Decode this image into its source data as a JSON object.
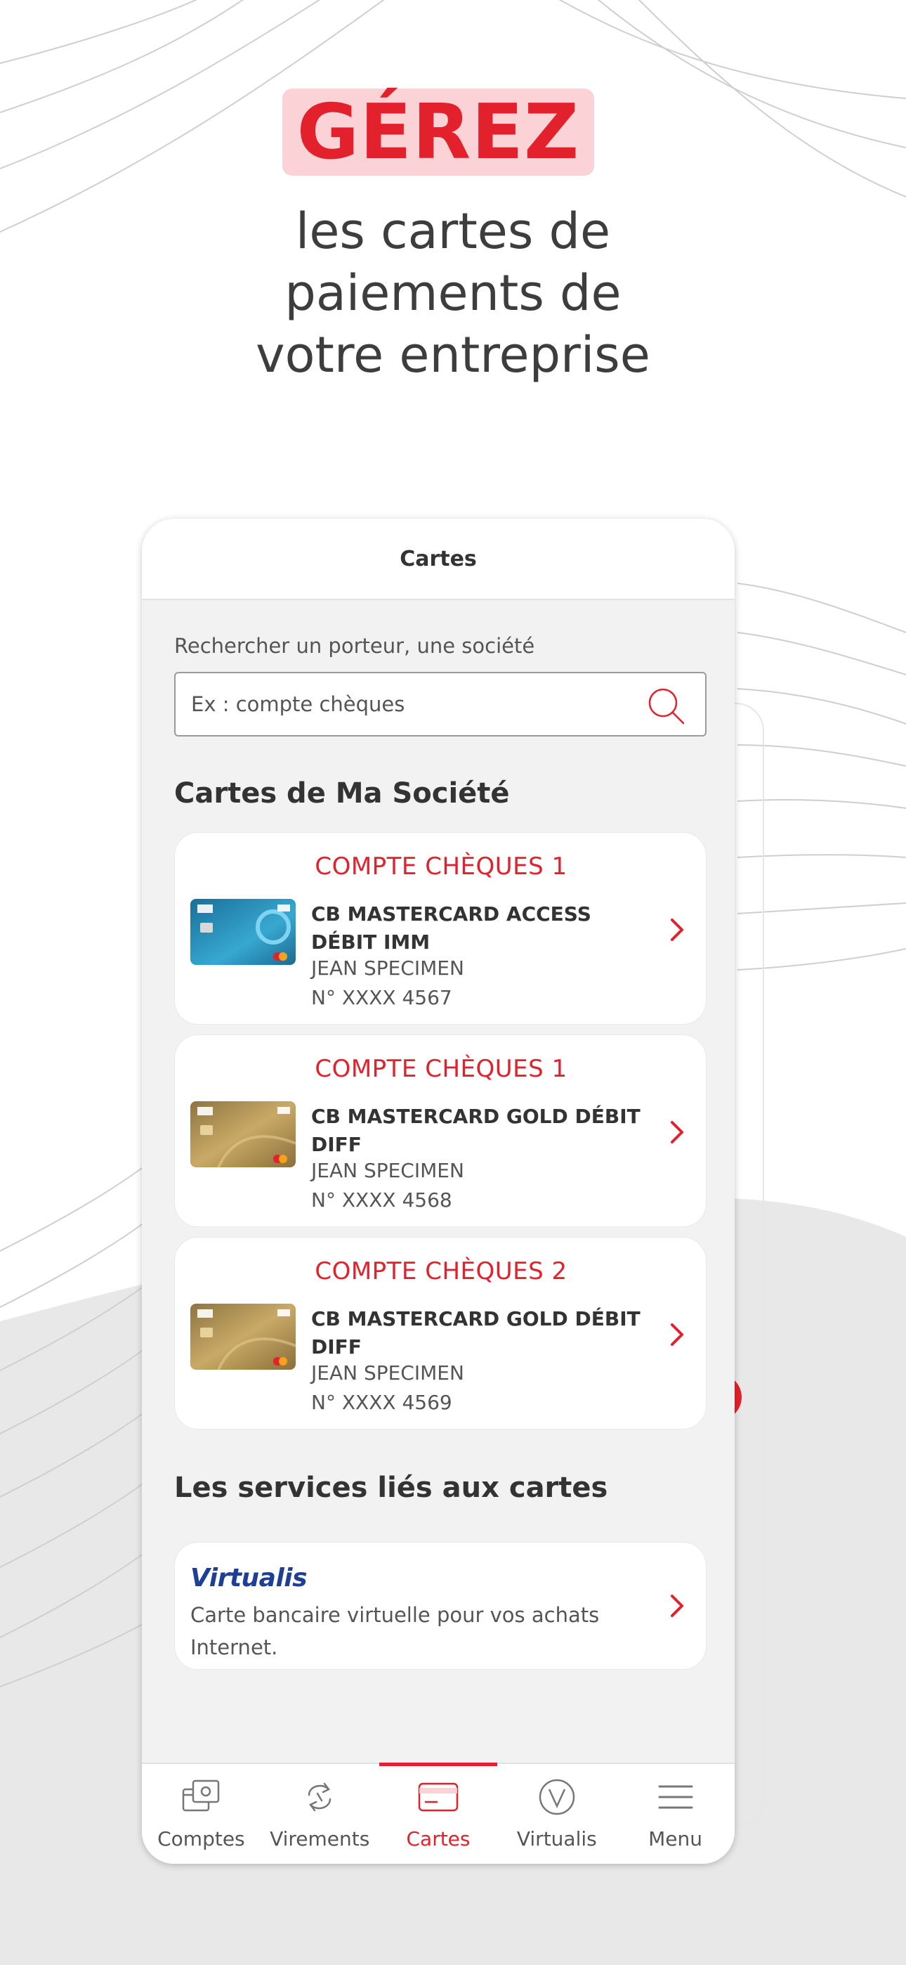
{
  "hero": {
    "badge": "GÉREZ",
    "subtitle_lines": [
      "les cartes de",
      "paiements de",
      "votre entreprise"
    ]
  },
  "colors": {
    "accent": "#e3212c",
    "badge_bg": "#fbd3d7",
    "screen_bg": "#f2f2f2",
    "virtualis_blue": "#1e3f96"
  },
  "app": {
    "header_title": "Cartes",
    "search": {
      "label": "Rechercher un porteur, une société",
      "placeholder": "Ex : compte chèques",
      "value": "",
      "icon": "search-icon"
    },
    "section_cards_title": "Cartes de Ma Société",
    "cards": [
      {
        "account": "COMPTE CHÈQUES 1",
        "name": "CB MASTERCARD ACCESS DÉBIT IMM",
        "holder": "JEAN SPECIMEN",
        "number": "N° XXXX 4567",
        "card_style": "blue-access"
      },
      {
        "account": "COMPTE CHÈQUES 1",
        "name": "CB MASTERCARD GOLD DÉBIT DIFF",
        "holder": "JEAN SPECIMEN",
        "number": "N° XXXX 4568",
        "card_style": "gold"
      },
      {
        "account": "COMPTE CHÈQUES 2",
        "name": "CB MASTERCARD GOLD DÉBIT DIFF",
        "holder": "JEAN SPECIMEN",
        "number": "N° XXXX 4569",
        "card_style": "gold"
      }
    ],
    "section_services_title": "Les services liés aux cartes",
    "service": {
      "logo": "Virtualis",
      "description": "Carte bancaire virtuelle pour vos achats Internet."
    },
    "tabs": [
      {
        "label": "Comptes",
        "icon": "accounts-icon",
        "active": false
      },
      {
        "label": "Virements",
        "icon": "transfer-icon",
        "active": false
      },
      {
        "label": "Cartes",
        "icon": "card-icon",
        "active": true
      },
      {
        "label": "Virtualis",
        "icon": "virtualis-icon",
        "active": false
      },
      {
        "label": "Menu",
        "icon": "menu-icon",
        "active": false
      }
    ]
  }
}
